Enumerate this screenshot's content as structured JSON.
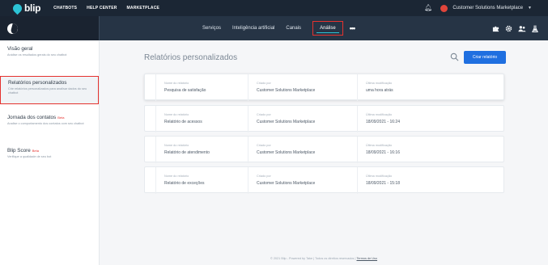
{
  "topbar": {
    "logo_text": "blip",
    "nav": [
      "CHATBOTS",
      "HELP CENTER",
      "MARKETPLACE"
    ],
    "org_name": "Customer Solutions Marketplace"
  },
  "subbar": {
    "tabs": [
      "Serviços",
      "Inteligência artificial",
      "Canais",
      "Análise"
    ],
    "active_tab": "Análise",
    "more_label": "•••"
  },
  "sidebar": {
    "items": [
      {
        "title": "Visão geral",
        "desc": "Análise os resultados gerais do seu chatbot",
        "beta": ""
      },
      {
        "title": "Relatórios personalizados",
        "desc": "Crie relatórios personalizados para analisar dados do seu chatbot",
        "beta": ""
      },
      {
        "title": "Jornada dos contatos",
        "desc": "Analise o comportamento dos contatos com seu chatbot",
        "beta": "Beta"
      },
      {
        "title": "Blip Score",
        "desc": "Verifique a qualidade de seu bot",
        "beta": "Beta"
      }
    ]
  },
  "main": {
    "title": "Relatórios personalizados",
    "create_button": "Criar relatório",
    "columns": [
      "Nome do relatório",
      "Criado por",
      "Última modificação"
    ],
    "reports": [
      {
        "name": "Pesquisa de satisfação",
        "created_by": "Customer Solutions Marketplace",
        "modified": "uma hora atrás"
      },
      {
        "name": "Relatório de acessos",
        "created_by": "Customer Solutions Marketplace",
        "modified": "18/09/2021 - 16:24"
      },
      {
        "name": "Relatório de atendimento",
        "created_by": "Customer Solutions Marketplace",
        "modified": "18/09/2021 - 16:16"
      },
      {
        "name": "Relatório de exceções",
        "created_by": "Customer Solutions Marketplace",
        "modified": "18/09/2021 - 15:18"
      }
    ]
  },
  "footer": {
    "text": "© 2021 Blip - Powered by Take | Todos os direitos reservados |",
    "link": "Termos de Uso"
  },
  "colors": {
    "topbar": "#1b2634",
    "subbar": "#263445",
    "accent_cyan": "#2cc3d5",
    "highlight_red": "#e5322e",
    "primary_button": "#1f6fe0"
  },
  "icons": [
    "bell-icon",
    "chevron-down-icon",
    "search-icon",
    "puzzle-icon",
    "gear-icon",
    "users-icon",
    "flask-icon"
  ]
}
